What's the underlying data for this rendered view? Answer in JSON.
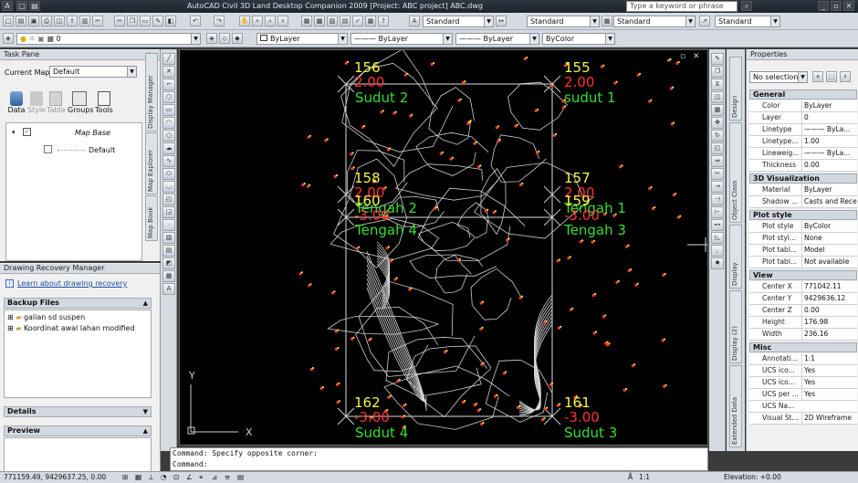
{
  "app": {
    "title": "AutoCAD Civil 3D Land Desktop Companion 2009 [Project: ABC project] ABC.dwg",
    "search_placeholder": "Type a keyword or phrase",
    "win_min": "_",
    "win_max": "▫",
    "win_close": "✕"
  },
  "toolbar": {
    "style1": "Standard",
    "style2": "Standard",
    "style3": "Standard",
    "style4": "Standard",
    "layer_value": "0",
    "color": "ByLayer",
    "linetype": "ByLayer",
    "lineweight": "ByLayer",
    "plotstyle": "ByColor"
  },
  "task_pane": {
    "header": "Task Pane",
    "current_map_label": "Current Map:",
    "current_map_value": "Default",
    "buttons": [
      "Data",
      "Style",
      "Table",
      "Groups",
      "Tools"
    ],
    "tree_root": "Map Base",
    "tree_child": "Default",
    "tabs": [
      "Display Manager",
      "Map Explorer",
      "Map Book"
    ]
  },
  "recovery": {
    "header": "Drawing Recovery Manager",
    "link": "Learn about drawing recovery",
    "backup_section": "Backup Files",
    "files": [
      "galian sd suspen",
      "Koordinat awal lahan modified"
    ],
    "details": "Details",
    "preview": "Preview"
  },
  "canvas": {
    "labels": [
      {
        "num": "156",
        "val": "2.00",
        "name": "Sudut 2"
      },
      {
        "num": "155",
        "val": "2.00",
        "name": "sudut 1"
      },
      {
        "num": "158",
        "val": "2.00",
        "name": "Tengah 2"
      },
      {
        "num": "160",
        "val": "-3.00",
        "name": "Tengah 4"
      },
      {
        "num": "157",
        "val": "2.00",
        "name": "Tengah 1"
      },
      {
        "num": "159",
        "val": "-3.00",
        "name": "Tengah 3"
      },
      {
        "num": "162",
        "val": "-3.00",
        "name": "Sudut 4"
      },
      {
        "num": "161",
        "val": "-3.00",
        "name": "Sudut 3"
      }
    ],
    "axis_y": "Y",
    "axis_x": "X",
    "viewport_controls": [
      "_",
      "▫",
      "✕"
    ]
  },
  "properties": {
    "header": "Properties",
    "selection": "No selection",
    "side_tabs": [
      "Design",
      "Object Class",
      "Display",
      "Display (2)",
      "Extended Data"
    ],
    "groups": [
      {
        "name": "General",
        "rows": [
          [
            "Color",
            "ByLayer"
          ],
          [
            "Layer",
            "0"
          ],
          [
            "Linetype",
            "——— ByLa..."
          ],
          [
            "Linetype...",
            "1.00"
          ],
          [
            "Lineweig...",
            "——— ByLa..."
          ],
          [
            "Thickness",
            "0.00"
          ]
        ]
      },
      {
        "name": "3D Visualization",
        "rows": [
          [
            "Material",
            "ByLayer"
          ],
          [
            "Shadow ...",
            "Casts and Receives"
          ]
        ]
      },
      {
        "name": "Plot style",
        "rows": [
          [
            "Plot style",
            "ByColor"
          ],
          [
            "Plot styl...",
            "None"
          ],
          [
            "Plot tabl...",
            "Model"
          ],
          [
            "Plot tabl...",
            "Not available"
          ]
        ]
      },
      {
        "name": "View",
        "rows": [
          [
            "Center X",
            "771042.11"
          ],
          [
            "Center Y",
            "9429636.12"
          ],
          [
            "Center Z",
            "0.00"
          ],
          [
            "Height",
            "176.98"
          ],
          [
            "Width",
            "236.16"
          ]
        ]
      },
      {
        "name": "Misc",
        "rows": [
          [
            "Annotati...",
            "1:1"
          ],
          [
            "UCS ico...",
            "Yes"
          ],
          [
            "UCS ico...",
            "Yes"
          ],
          [
            "UCS per ...",
            "Yes"
          ],
          [
            "UCS Na...",
            ""
          ],
          [
            "Visual St...",
            "2D Wireframe"
          ]
        ]
      }
    ]
  },
  "command": {
    "line1": "Command: Specify opposite corner:",
    "line2": "Command:"
  },
  "status": {
    "coords": "771159.49, 9429637.25, 0.00",
    "scale": "1:1",
    "elevation": "Elevation: +0.00"
  }
}
